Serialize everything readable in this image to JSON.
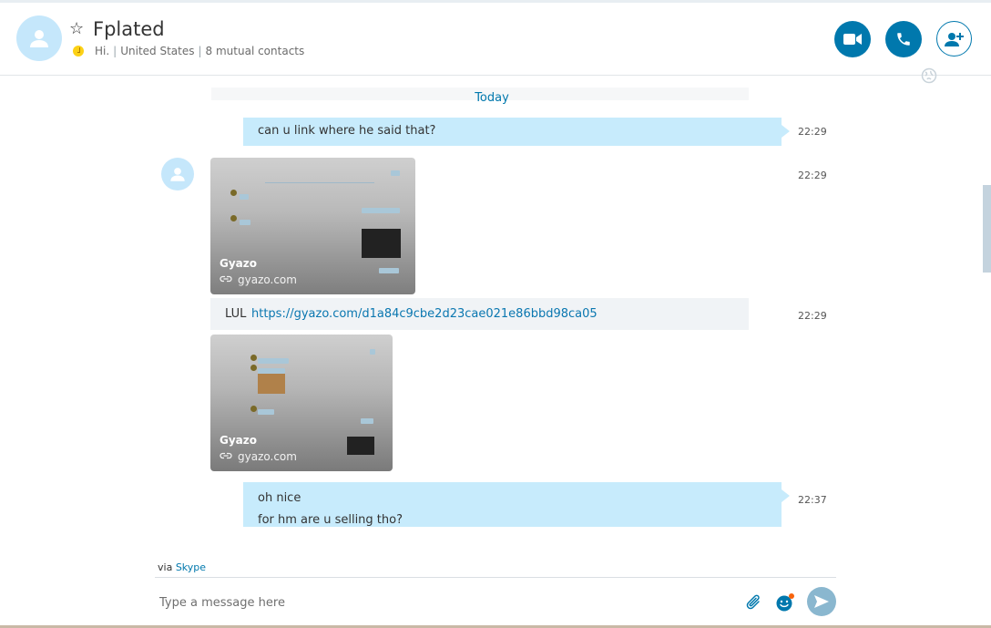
{
  "contact": {
    "name": "Fplated",
    "mood": "Hi.",
    "location": "United States",
    "mutual": "8 mutual contacts"
  },
  "header_icons": {
    "video": "video-camera-icon",
    "call": "phone-icon",
    "add": "add-person-icon",
    "favorite": "star-icon",
    "status": "away-clock-icon"
  },
  "chat": {
    "date_divider": "Today",
    "messages": [
      {
        "type": "outgoing",
        "text": "can u link where he said that?",
        "time": "22:29"
      },
      {
        "type": "preview",
        "title": "Gyazo",
        "domain": "gyazo.com",
        "time": "22:29"
      },
      {
        "type": "incoming",
        "prefix": "LUL",
        "link": "https://gyazo.com/d1a84c9cbe2d23cae021e86bbd98ca05",
        "time": "22:29"
      },
      {
        "type": "preview",
        "title": "Gyazo",
        "domain": "gyazo.com"
      },
      {
        "type": "outgoing",
        "lines": [
          "oh nice",
          "for hm are u selling tho?"
        ],
        "time": "22:37"
      }
    ]
  },
  "compose": {
    "via_prefix": "via",
    "via_service": "Skype",
    "placeholder": "Type a message here"
  },
  "colors": {
    "accent": "#0078ad",
    "outgoing_bubble": "#c7ebfc",
    "incoming_bubble": "#f0f3f6",
    "avatar_bg": "#c5e7fb",
    "status_away": "#fcd116"
  }
}
